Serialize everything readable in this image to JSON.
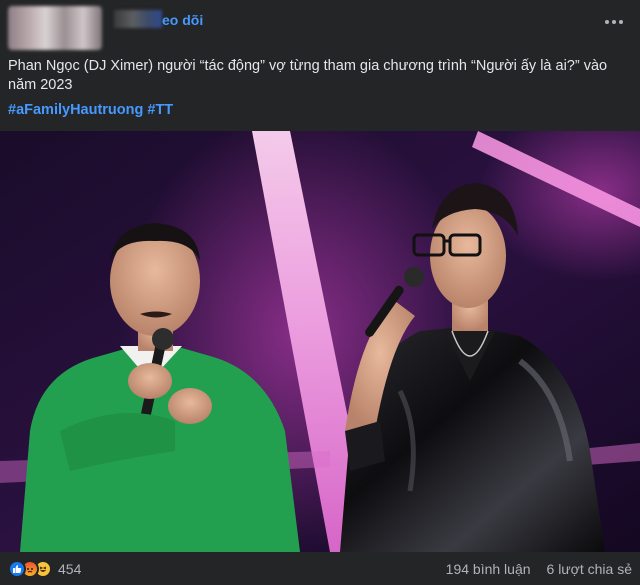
{
  "header": {
    "follow_label": "eo dõi"
  },
  "post": {
    "caption": "Phan Ngọc (DJ Ximer)  người “tác động” vợ từng tham gia chương trình “Người ấy là ai?” vào năm 2023",
    "hashtags": [
      "#aFamilyHautruong",
      "#TT"
    ]
  },
  "footer": {
    "reaction_count": "454",
    "reaction_icons": [
      "like-icon",
      "angry-icon",
      "haha-icon"
    ],
    "comments": "194 bình luận",
    "shares": "6 lượt chia sẻ"
  },
  "colors": {
    "background": "#242526",
    "text": "#e4e6eb",
    "link": "#4599ff",
    "muted": "#b0b3b8"
  }
}
